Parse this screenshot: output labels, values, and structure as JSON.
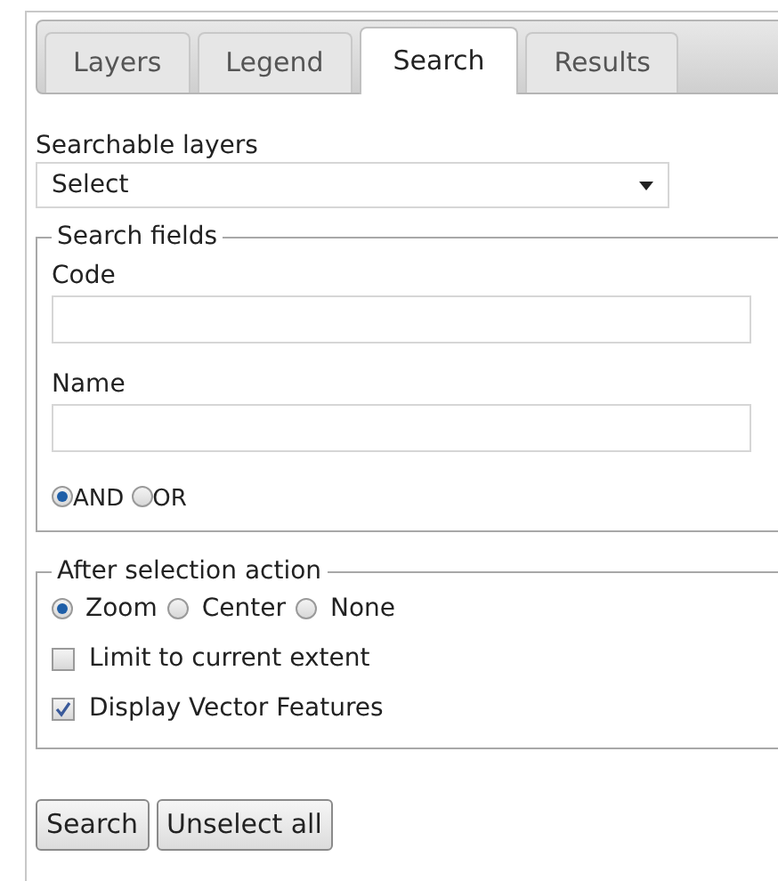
{
  "tabs": [
    {
      "label": "Layers",
      "selected": false
    },
    {
      "label": "Legend",
      "selected": false
    },
    {
      "label": "Search",
      "selected": true
    },
    {
      "label": "Results",
      "selected": false
    }
  ],
  "searchable_layers": {
    "label": "Searchable layers",
    "value": "Select"
  },
  "search_fields": {
    "legend": "Search fields",
    "fields": [
      {
        "label": "Code"
      },
      {
        "label": "Name"
      }
    ],
    "operators": [
      {
        "label": "AND",
        "selected": true
      },
      {
        "label": "OR",
        "selected": false
      }
    ]
  },
  "after_selection": {
    "legend": "After selection action",
    "actions": [
      {
        "label": "Zoom",
        "selected": true
      },
      {
        "label": "Center",
        "selected": false
      },
      {
        "label": "None",
        "selected": false
      }
    ],
    "options": [
      {
        "label": "Limit to current extent",
        "checked": false
      },
      {
        "label": "Display Vector Features",
        "checked": true
      }
    ]
  },
  "buttons": [
    "Search",
    "Unselect all"
  ]
}
